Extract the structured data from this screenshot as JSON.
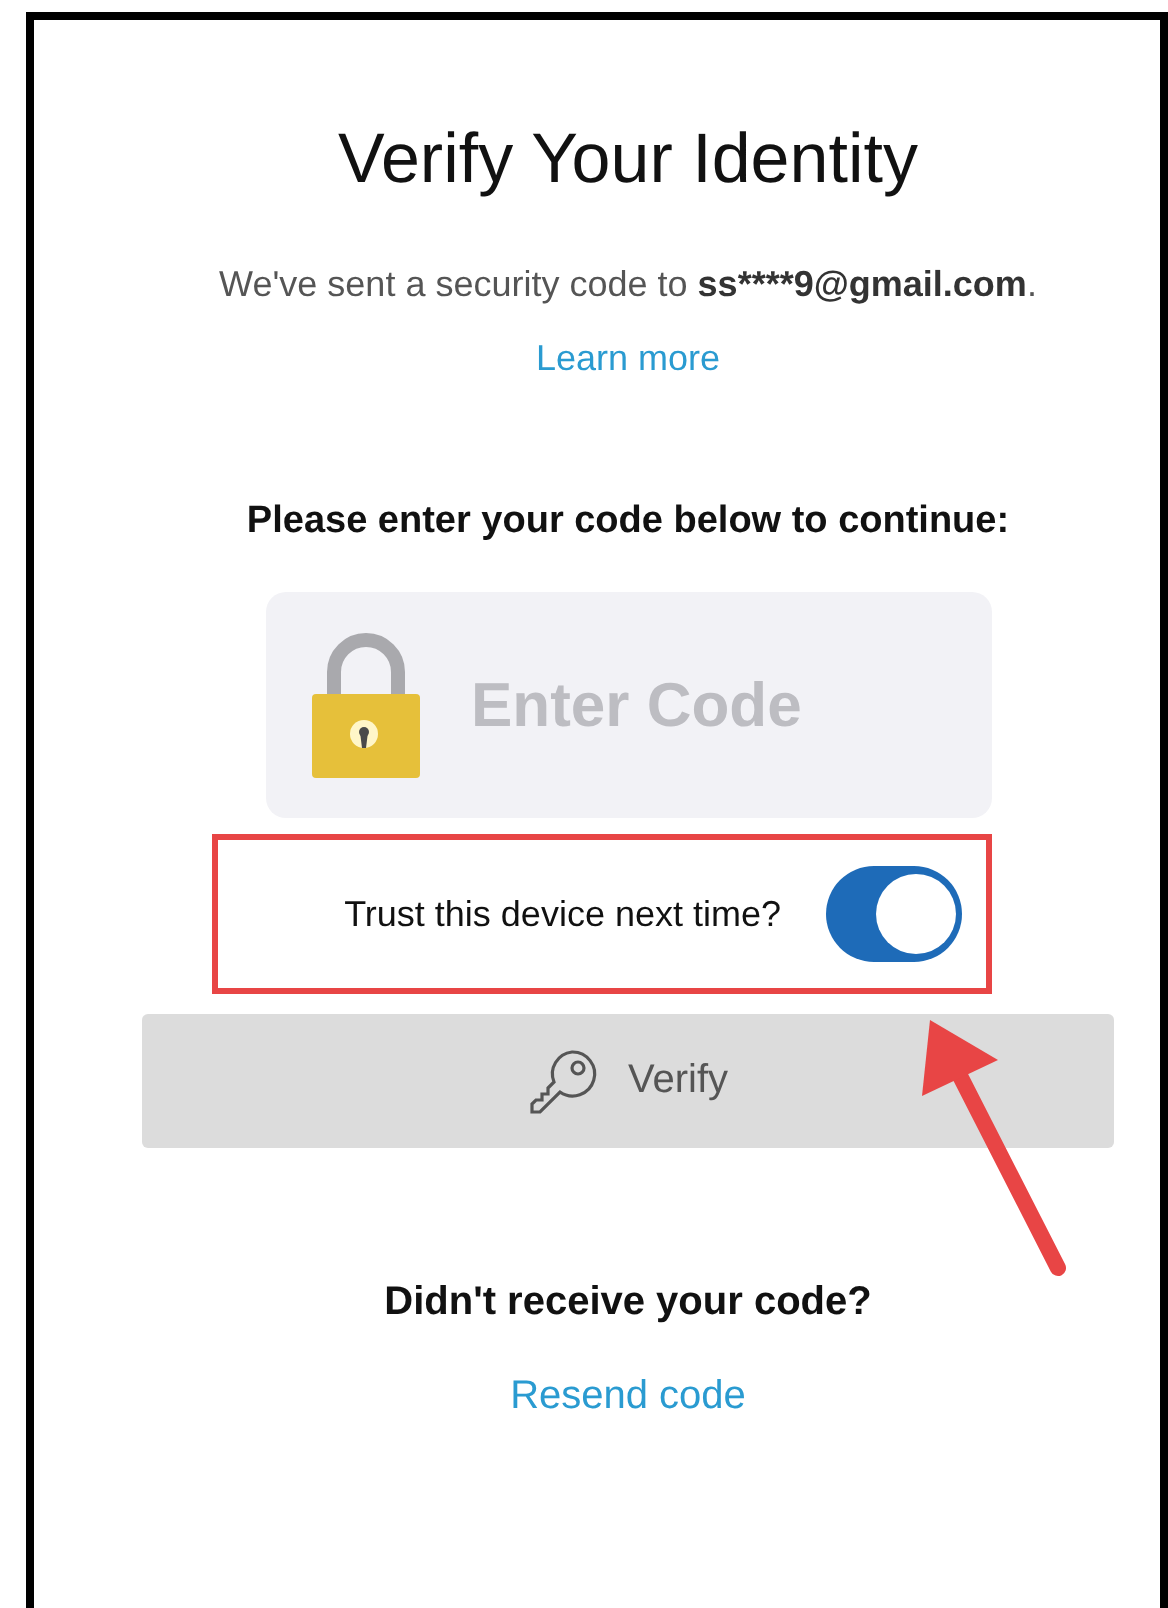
{
  "title": "Verify Your Identity",
  "message": {
    "text": "We've sent a security code to",
    "email": "ss****9@gmail.com",
    "end": "."
  },
  "learn_more_link": "Learn more",
  "prompt": "Please enter your code below to continue:",
  "code_field": {
    "placeholder": "Enter Code"
  },
  "trust_device": {
    "label": "Trust this device next time?",
    "on": true
  },
  "verify_button": {
    "label": "Verify"
  },
  "resend": {
    "question": "Didn't receive your code?",
    "link": "Resend code"
  }
}
